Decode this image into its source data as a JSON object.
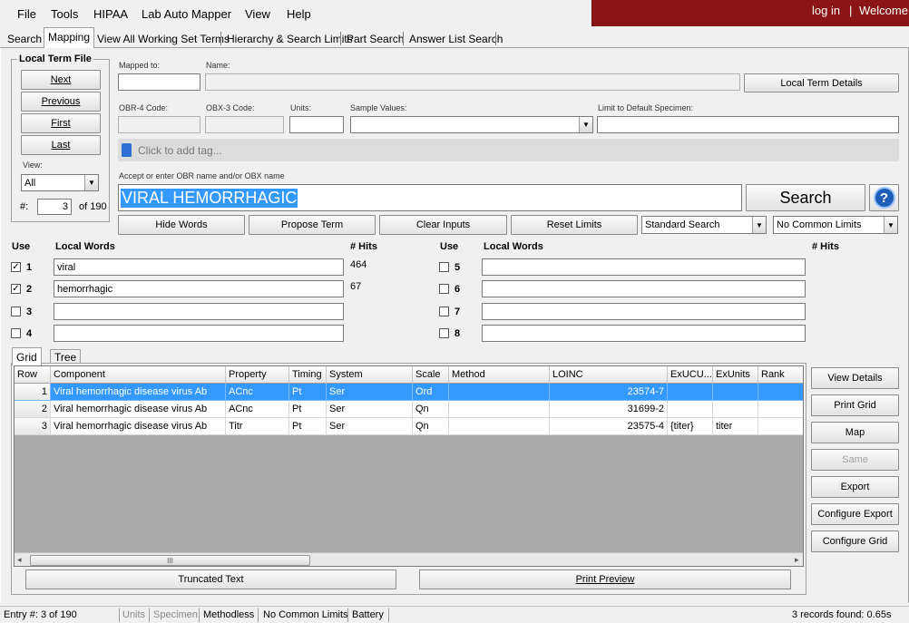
{
  "menu": [
    "File",
    "Tools",
    "HIPAA",
    "Lab Auto Mapper",
    "View",
    "Help"
  ],
  "topbar": {
    "login": "log in",
    "sep": "|",
    "welcome": "Welcome"
  },
  "tabs": [
    "Search",
    "Mapping",
    "View All Working Set Terms",
    "Hierarchy & Search Limits",
    "Part Search",
    "Answer List Search"
  ],
  "local_term_file": {
    "title": "Local Term File",
    "next": "Next",
    "previous": "Previous",
    "first": "First",
    "last": "Last",
    "view_label": "View:",
    "view_value": "All",
    "num_label": "#:",
    "num_value": "3",
    "of_total": "of 190"
  },
  "form": {
    "mapped_to_label": "Mapped to:",
    "name_label": "Name:",
    "local_term_details": "Local Term Details",
    "obr4_label": "OBR-4 Code:",
    "obx3_label": "OBX-3 Code:",
    "units_label": "Units:",
    "sample_values_label": "Sample Values:",
    "limit_specimen_label": "Limit to Default Specimen:",
    "tag_placeholder": "Click to add tag...",
    "accept_label": "Accept or enter OBR name and/or OBX name",
    "search_text": "VIRAL HEMORRHAGIC",
    "search_button": "Search",
    "help_glyph": "?"
  },
  "actions": {
    "hide_words": "Hide Words",
    "propose_term": "Propose Term",
    "clear_inputs": "Clear Inputs",
    "reset_limits": "Reset Limits",
    "search_mode": "Standard Search",
    "common_limits": "No Common Limits"
  },
  "words": {
    "use_label": "Use",
    "local_words_label": "Local Words",
    "hits_label": "# Hits",
    "left": [
      {
        "n": "1",
        "checked": "✓",
        "word": "viral",
        "hits": "464"
      },
      {
        "n": "2",
        "checked": "✓",
        "word": "hemorrhagic",
        "hits": "67"
      },
      {
        "n": "3",
        "checked": "",
        "word": "",
        "hits": ""
      },
      {
        "n": "4",
        "checked": "",
        "word": "",
        "hits": ""
      }
    ],
    "right": [
      {
        "n": "5",
        "checked": "",
        "word": ""
      },
      {
        "n": "6",
        "checked": "",
        "word": ""
      },
      {
        "n": "7",
        "checked": "",
        "word": ""
      },
      {
        "n": "8",
        "checked": "",
        "word": ""
      }
    ]
  },
  "grid_tabs": [
    "Grid",
    "Tree"
  ],
  "grid": {
    "columns": [
      "Row",
      "Component",
      "Property",
      "Timing",
      "System",
      "Scale",
      "Method",
      "LOINC",
      "ExUCU...",
      "ExUnits",
      "Rank"
    ],
    "rows": [
      {
        "row": "1",
        "component": "Viral hemorrhagic disease virus Ab",
        "property": "ACnc",
        "timing": "Pt",
        "system": "Ser",
        "scale": "Ord",
        "method": "",
        "loinc": "23574-7",
        "exucum": "",
        "exunits": "",
        "rank": ""
      },
      {
        "row": "2",
        "component": "Viral hemorrhagic disease virus Ab",
        "property": "ACnc",
        "timing": "Pt",
        "system": "Ser",
        "scale": "Qn",
        "method": "",
        "loinc": "31699-2",
        "exucum": "",
        "exunits": "",
        "rank": ""
      },
      {
        "row": "3",
        "component": "Viral hemorrhagic disease virus Ab",
        "property": "Titr",
        "timing": "Pt",
        "system": "Ser",
        "scale": "Qn",
        "method": "",
        "loinc": "23575-4",
        "exucum": "{titer}",
        "exunits": "titer",
        "rank": ""
      }
    ]
  },
  "scroll_grip": "III",
  "side_buttons": [
    "View Details",
    "Print Grid",
    "Map",
    "Same",
    "Export",
    "Configure Export",
    "Configure Grid"
  ],
  "bottom_buttons": {
    "truncated": "Truncated Text",
    "print_preview": "Print Preview"
  },
  "status": {
    "entry": "Entry #: 3 of 190",
    "units": "Units",
    "specimen": "Specimen",
    "methodless": "Methodless",
    "common": "No Common Limits",
    "battery": "Battery",
    "records": "3 records found: 0.65s"
  }
}
